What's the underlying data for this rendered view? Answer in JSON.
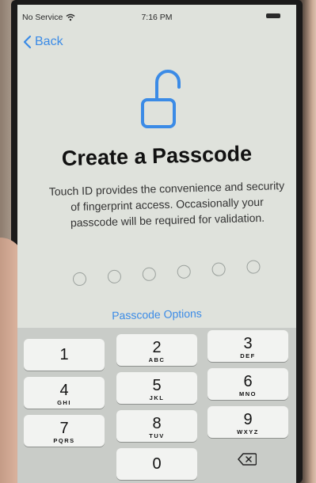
{
  "status_bar": {
    "carrier": "No Service",
    "time": "7:16 PM"
  },
  "nav": {
    "back_label": "Back"
  },
  "title": "Create a Passcode",
  "description": "Touch ID provides the convenience and security of fingerprint access. Occasionally your passcode will be required for validation.",
  "passcode_length": 6,
  "passcode_options_label": "Passcode Options",
  "keypad": [
    {
      "num": "1",
      "letters": ""
    },
    {
      "num": "2",
      "letters": "ABC"
    },
    {
      "num": "3",
      "letters": "DEF"
    },
    {
      "num": "4",
      "letters": "GHI"
    },
    {
      "num": "5",
      "letters": "JKL"
    },
    {
      "num": "6",
      "letters": "MNO"
    },
    {
      "num": "7",
      "letters": "PQRS"
    },
    {
      "num": "8",
      "letters": "TUV"
    },
    {
      "num": "9",
      "letters": "WXYZ"
    },
    {
      "num": "0",
      "letters": ""
    }
  ],
  "icons": {
    "lock": "unlocked-padlock-icon",
    "delete": "delete-backspace-icon",
    "wifi": "wifi-icon",
    "back": "chevron-left-icon"
  },
  "colors": {
    "accent": "#3b8be6",
    "screen_bg": "#dfe2dc",
    "keypad_bg": "#c9ccc8"
  }
}
